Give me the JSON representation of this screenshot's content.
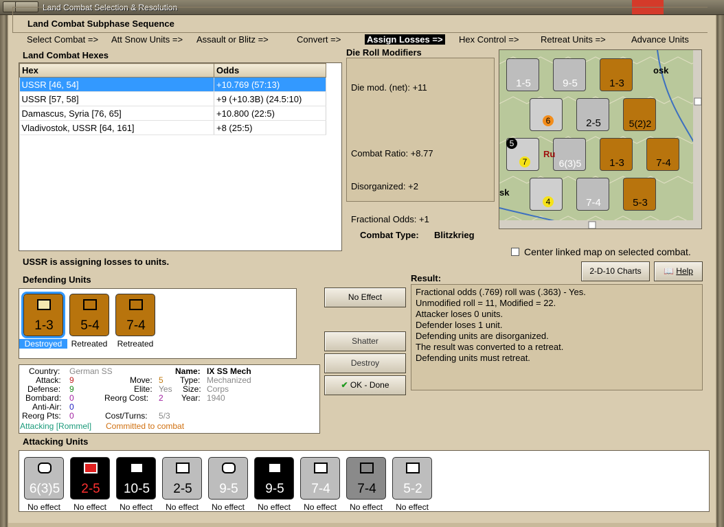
{
  "window": {
    "title": "Land Combat Selection & Resolution"
  },
  "sequence": {
    "title": "Land Combat Subphase Sequence",
    "steps": [
      "Select Combat =>",
      "Att Snow Units =>",
      "Assault or Blitz =>",
      "Convert =>",
      "Assign Losses =>",
      "Hex Control =>",
      "Retreat Units =>",
      "Advance Units"
    ],
    "active_index": 4
  },
  "hexes": {
    "title": "Land Combat Hexes",
    "headers": [
      "Hex",
      "Odds"
    ],
    "rows": [
      {
        "hex": "USSR [46, 54]",
        "odds": "+10.769 (57:13)"
      },
      {
        "hex": "USSR [57, 58]",
        "odds": "+9 (+10.3B) (24.5:10)"
      },
      {
        "hex": "Damascus, Syria [76, 65]",
        "odds": "+10.800 (22:5)"
      },
      {
        "hex": "Vladivostok, USSR [64, 161]",
        "odds": "+8 (25:5)"
      }
    ]
  },
  "die_roll": {
    "title": "Die Roll Modifiers",
    "lines": [
      "Die mod. (net): +11",
      "",
      "Combat Ratio: +8.77",
      "Disorganized: +2",
      "Fractional Odds: +1"
    ]
  },
  "combat_type": {
    "label": "Combat Type:",
    "value": "Blitzkrieg"
  },
  "center_map": {
    "label": "Center linked map on selected combat.",
    "checked": false
  },
  "buttons": {
    "charts": "2-D-10 Charts",
    "help": "Help",
    "no_effect": "No Effect",
    "shatter": "Shatter",
    "destroy": "Destroy",
    "ok_done": "OK - Done"
  },
  "status": "USSR is assigning losses to units.",
  "defending": {
    "title": "Defending Units",
    "units": [
      {
        "value": "1-3",
        "caption": "Destroyed",
        "color": "#b8740d",
        "selected": true
      },
      {
        "value": "5-4",
        "caption": "Retreated",
        "color": "#b8740d",
        "selected": false
      },
      {
        "value": "7-4",
        "caption": "Retreated",
        "color": "#b8740d",
        "selected": false
      }
    ]
  },
  "result": {
    "title": "Result:",
    "lines": [
      "Fractional odds (.769) roll was (.363)  - Yes.",
      "Unmodified roll = 11, Modified = 22.",
      "Attacker loses 0 units.",
      "Defender loses 1 unit.",
      "Defending units are disorganized.",
      "The result was converted to a retreat.",
      "Defending units must retreat."
    ]
  },
  "unit_info": {
    "country_label": "Country:",
    "country": "German SS",
    "attack_label": "Attack:",
    "attack": "9",
    "defense_label": "Defense:",
    "defense": "9",
    "bombard_label": "Bombard:",
    "bombard": "0",
    "antiair_label": "Anti-Air:",
    "antiair": "0",
    "reorgpts_label": "Reorg Pts:",
    "reorgpts": "0",
    "move_label": "Move:",
    "move": "5",
    "elite_label": "Elite:",
    "elite": "Yes",
    "reorgcost_label": "Reorg Cost:",
    "reorgcost": "2",
    "costturns_label": "Cost/Turns:",
    "costturns": "5/3",
    "name_label": "Name:",
    "name": "IX SS Mech",
    "type_label": "Type:",
    "type": "Mechanized",
    "size_label": "Size:",
    "size": "Corps",
    "year_label": "Year:",
    "year": "1940",
    "attacking_note": "Attacking [Rommel]",
    "committed_note": "Committed to combat"
  },
  "attacking": {
    "title": "Attacking Units",
    "units": [
      {
        "value": "6(3)5",
        "caption": "No effect",
        "color": "#bdbdbd",
        "text_color": "#ffffff"
      },
      {
        "value": "2-5",
        "caption": "No effect",
        "color": "#000000",
        "text_color": "#ff3030"
      },
      {
        "value": "10-5",
        "caption": "No effect",
        "color": "#000000",
        "text_color": "#ffffff"
      },
      {
        "value": "2-5",
        "caption": "No effect",
        "color": "#bdbdbd",
        "text_color": "#000000"
      },
      {
        "value": "9-5",
        "caption": "No effect",
        "color": "#bdbdbd",
        "text_color": "#ffffff"
      },
      {
        "value": "9-5",
        "caption": "No effect",
        "color": "#000000",
        "text_color": "#ffffff"
      },
      {
        "value": "7-4",
        "caption": "No effect",
        "color": "#bdbdbd",
        "text_color": "#ffffff"
      },
      {
        "value": "7-4",
        "caption": "No effect",
        "color": "#8a8a8a",
        "text_color": "#000000"
      },
      {
        "value": "5-2",
        "caption": "No effect",
        "color": "#bdbdbd",
        "text_color": "#ffffff"
      }
    ]
  },
  "map": {
    "labels": [
      "osk",
      "Ru",
      "sk"
    ],
    "counters": [
      "1-5",
      "9-5",
      "1-3",
      "2-5",
      "5(2)2",
      "6(3)5",
      "1-3",
      "7-4",
      "7-4",
      "5-3"
    ],
    "air_values": [
      "6",
      "7",
      "4",
      "5"
    ]
  }
}
